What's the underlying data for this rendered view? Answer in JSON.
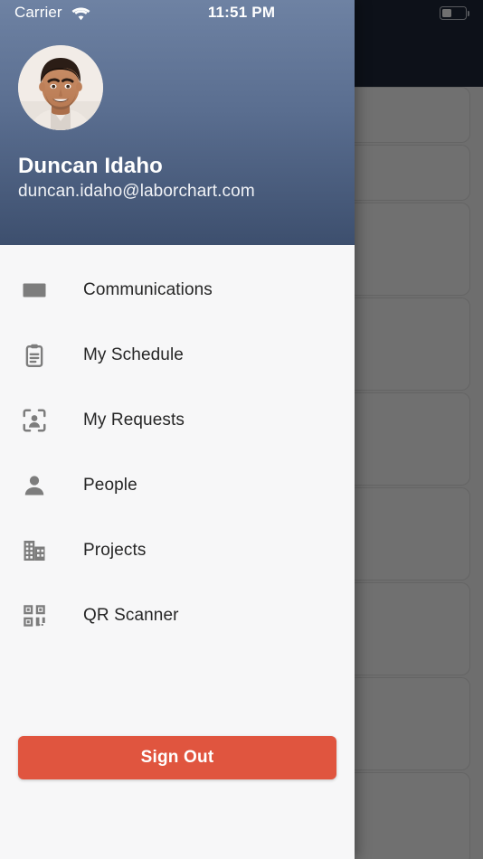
{
  "status_bar": {
    "carrier": "Carrier",
    "wifi_icon": "wifi-icon",
    "time": "11:51 PM",
    "battery_icon": "battery-icon",
    "battery_level_percent": 38
  },
  "drawer": {
    "header": {
      "avatar_icon": "user-avatar-photo",
      "user_name": "Duncan Idaho",
      "user_email": "duncan.idaho@laborchart.com",
      "gradient_top_color": "#6e82a3",
      "gradient_bottom_color": "#3d4f6e"
    },
    "menu_items": [
      {
        "label": "Communications",
        "icon": "envelope-icon"
      },
      {
        "label": "My Schedule",
        "icon": "clipboard-icon"
      },
      {
        "label": "My Requests",
        "icon": "person-in-dashed-frame-icon"
      },
      {
        "label": "People",
        "icon": "person-icon"
      },
      {
        "label": "Projects",
        "icon": "buildings-icon"
      },
      {
        "label": "QR Scanner",
        "icon": "qr-code-icon"
      }
    ],
    "sign_out": {
      "label": "Sign Out",
      "color": "#e0553f"
    }
  },
  "background": {
    "scrim_color": "rgba(0,0,0,0.56)",
    "status_bar_color": "#1e2739",
    "card_heights": [
      62,
      62,
      103,
      103,
      103,
      103,
      103,
      103,
      103
    ]
  }
}
